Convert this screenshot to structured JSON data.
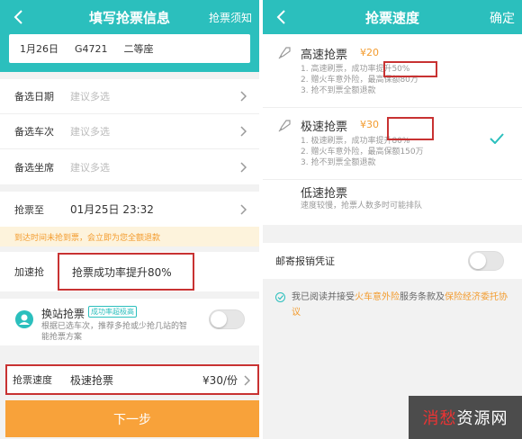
{
  "left": {
    "header": {
      "title": "填写抢票信息",
      "right_link": "抢票须知"
    },
    "trip": {
      "date": "1月26日",
      "train": "G4721",
      "seat": "二等座"
    },
    "alternates": [
      {
        "label": "备选日期",
        "placeholder": "建议多选"
      },
      {
        "label": "备选车次",
        "placeholder": "建议多选"
      },
      {
        "label": "备选坐席",
        "placeholder": "建议多选"
      }
    ],
    "grab_until": {
      "label": "抢票至",
      "value": "01月25日 23:32"
    },
    "notice": "到达时间未抢到票，会立即为您全额退款",
    "accel": {
      "label": "加速抢",
      "value": "抢票成功率提升80%"
    },
    "swap": {
      "title": "换站抢票",
      "badge": "成功率超极高",
      "desc": "根据已选车次，推荐多抢或少抢几站的智能抢票方案",
      "toggle_on": false
    },
    "speed": {
      "label": "抢票速度",
      "value": "极速抢票",
      "price": "¥30/份"
    },
    "next_button": "下一步"
  },
  "right": {
    "header": {
      "title": "抢票速度",
      "right_link": "确定"
    },
    "options": [
      {
        "title": "高速抢票",
        "price": "¥20",
        "lines": [
          "1. 高速刷票，成功率提升50%",
          "2. 赠火车意外险，最高保额80万",
          "3. 抢不到票全额退款"
        ],
        "selected": false
      },
      {
        "title": "极速抢票",
        "price": "¥30",
        "lines": [
          "1. 极速刷票，成功率提升80%",
          "2. 赠火车意外险，最高保额150万",
          "3. 抢不到票全额退款"
        ],
        "selected": true
      },
      {
        "title": "低速抢票",
        "price": "",
        "lines": [
          "速度较慢，抢票人数多时可能排队"
        ],
        "selected": false
      }
    ],
    "mail": {
      "label": "邮寄报销凭证",
      "toggle_on": false
    },
    "agree": {
      "prefix": "我已阅读并接受",
      "link1": "火车意外险",
      "middle": "服务条款及",
      "link2": "保险经济委托协议"
    }
  },
  "watermark": {
    "part1": "消愁",
    "part2": "资源网"
  },
  "colors": {
    "accent": "#2bbfbd",
    "orange": "#f8a23a",
    "highlight": "#c83232"
  }
}
